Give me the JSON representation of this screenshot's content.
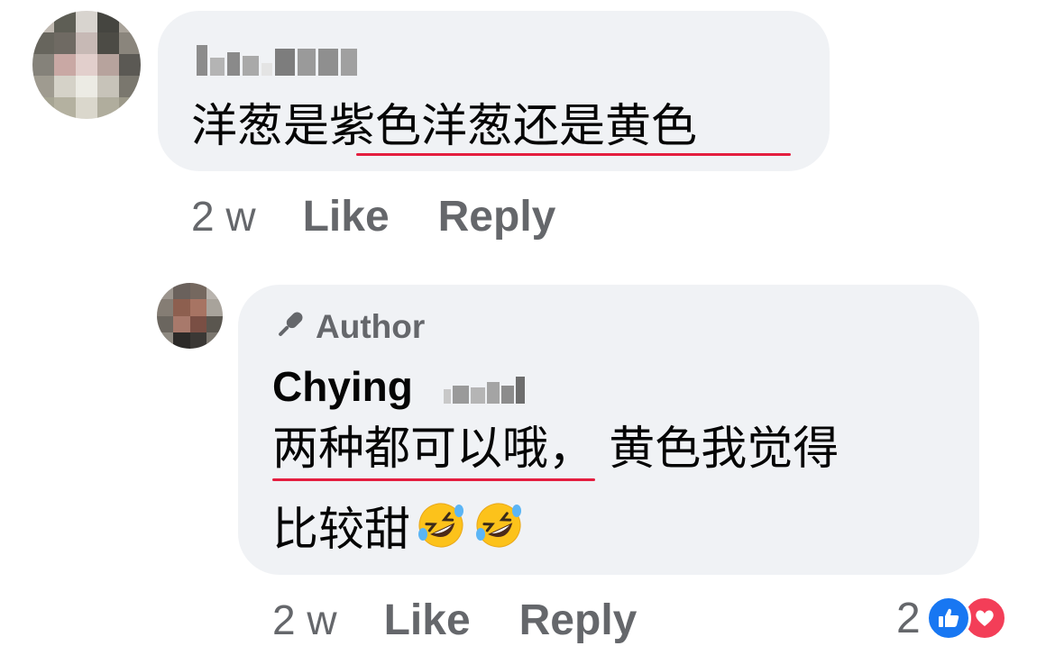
{
  "colors": {
    "bubble_bg": "#f0f2f5",
    "text_primary": "#050505",
    "text_secondary": "#65676b",
    "spellcheck_underline": "#e41e3f",
    "like_blue": "#1877f2",
    "love_red": "#f33e58"
  },
  "comment1": {
    "author_visible": "blurred",
    "text": "洋葱是紫色洋葱还是黄色",
    "timestamp": "2 w",
    "like_label": "Like",
    "reply_label": "Reply"
  },
  "comment2": {
    "badge_icon": "microphone-icon",
    "badge_label": "Author",
    "author_name": "Chying",
    "text_line1": "两种都可以哦， 黄色我觉得",
    "text_line2": "比较甜",
    "emojis": [
      "rolling-on-floor-laughing-emoji",
      "rolling-on-floor-laughing-emoji"
    ],
    "timestamp": "2 w",
    "like_label": "Like",
    "reply_label": "Reply",
    "reaction_count": "2",
    "reactions": [
      "like-reaction-icon",
      "love-reaction-icon"
    ]
  }
}
